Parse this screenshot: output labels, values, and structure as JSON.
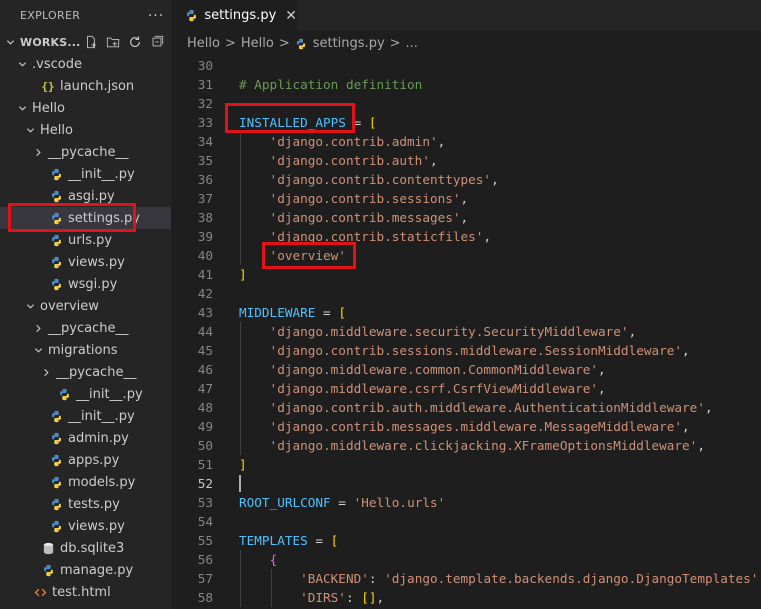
{
  "sidebar": {
    "title": "EXPLORER",
    "more": "···",
    "tree": [
      {
        "label": "WORKS...",
        "depth": 0,
        "chev": "down",
        "icon": "none",
        "workspace": true
      },
      {
        "label": ".vscode",
        "depth": 1,
        "chev": "down",
        "icon": "none"
      },
      {
        "label": "launch.json",
        "depth": 2,
        "chev": "none",
        "icon": "json"
      },
      {
        "label": "Hello",
        "depth": 1,
        "chev": "down",
        "icon": "none"
      },
      {
        "label": "Hello",
        "depth": 2,
        "chev": "down",
        "icon": "none"
      },
      {
        "label": "__pycache__",
        "depth": 3,
        "chev": "right",
        "icon": "none"
      },
      {
        "label": "__init__.py",
        "depth": 3,
        "chev": "none",
        "icon": "python"
      },
      {
        "label": "asgi.py",
        "depth": 3,
        "chev": "none",
        "icon": "python"
      },
      {
        "label": "settings.py",
        "depth": 3,
        "chev": "none",
        "icon": "python",
        "selected": true
      },
      {
        "label": "urls.py",
        "depth": 3,
        "chev": "none",
        "icon": "python"
      },
      {
        "label": "views.py",
        "depth": 3,
        "chev": "none",
        "icon": "python"
      },
      {
        "label": "wsgi.py",
        "depth": 3,
        "chev": "none",
        "icon": "python"
      },
      {
        "label": "overview",
        "depth": 2,
        "chev": "down",
        "icon": "none"
      },
      {
        "label": "__pycache__",
        "depth": 3,
        "chev": "right",
        "icon": "none"
      },
      {
        "label": "migrations",
        "depth": 3,
        "chev": "down",
        "icon": "none"
      },
      {
        "label": "__pycache__",
        "depth": 4,
        "chev": "right",
        "icon": "none"
      },
      {
        "label": "__init__.py",
        "depth": 4,
        "chev": "none",
        "icon": "python"
      },
      {
        "label": "__init__.py",
        "depth": 3,
        "chev": "none",
        "icon": "python"
      },
      {
        "label": "admin.py",
        "depth": 3,
        "chev": "none",
        "icon": "python"
      },
      {
        "label": "apps.py",
        "depth": 3,
        "chev": "none",
        "icon": "python"
      },
      {
        "label": "models.py",
        "depth": 3,
        "chev": "none",
        "icon": "python"
      },
      {
        "label": "tests.py",
        "depth": 3,
        "chev": "none",
        "icon": "python"
      },
      {
        "label": "views.py",
        "depth": 3,
        "chev": "none",
        "icon": "python"
      },
      {
        "label": "db.sqlite3",
        "depth": 2,
        "chev": "none",
        "icon": "database"
      },
      {
        "label": "manage.py",
        "depth": 2,
        "chev": "none",
        "icon": "python"
      },
      {
        "label": "test.html",
        "depth": 1,
        "chev": "none",
        "icon": "html"
      }
    ]
  },
  "tab": {
    "label": "settings.py",
    "close": "✕"
  },
  "breadcrumbs": {
    "items": [
      "Hello",
      "Hello",
      "settings.py",
      "..."
    ],
    "sep": ">"
  },
  "colors": {
    "highlight": "#e0131a",
    "python_blue": "#4f8fc9",
    "python_yellow": "#f7d44a"
  },
  "editor": {
    "lines": [
      {
        "n": "30",
        "t": []
      },
      {
        "n": "31",
        "t": [
          {
            "c": "comment",
            "s": "# Application definition"
          }
        ]
      },
      {
        "n": "32",
        "t": []
      },
      {
        "n": "33",
        "t": [
          {
            "c": "var",
            "s": "INSTALLED_APPS"
          },
          {
            "c": "op",
            "s": " = "
          },
          {
            "c": "b1",
            "s": "["
          }
        ]
      },
      {
        "n": "34",
        "t": [
          {
            "c": "str",
            "s": "    'django.contrib.admin'"
          },
          {
            "c": "op",
            "s": ","
          }
        ]
      },
      {
        "n": "35",
        "t": [
          {
            "c": "str",
            "s": "    'django.contrib.auth'"
          },
          {
            "c": "op",
            "s": ","
          }
        ]
      },
      {
        "n": "36",
        "t": [
          {
            "c": "str",
            "s": "    'django.contrib.contenttypes'"
          },
          {
            "c": "op",
            "s": ","
          }
        ]
      },
      {
        "n": "37",
        "t": [
          {
            "c": "str",
            "s": "    'django.contrib.sessions'"
          },
          {
            "c": "op",
            "s": ","
          }
        ]
      },
      {
        "n": "38",
        "t": [
          {
            "c": "str",
            "s": "    'django.contrib.messages'"
          },
          {
            "c": "op",
            "s": ","
          }
        ]
      },
      {
        "n": "39",
        "t": [
          {
            "c": "str",
            "s": "    'django.contrib.staticfiles'"
          },
          {
            "c": "op",
            "s": ","
          }
        ]
      },
      {
        "n": "40",
        "t": [
          {
            "c": "str",
            "s": "    'overview'"
          }
        ]
      },
      {
        "n": "41",
        "t": [
          {
            "c": "b1",
            "s": "]"
          }
        ]
      },
      {
        "n": "42",
        "t": []
      },
      {
        "n": "43",
        "t": [
          {
            "c": "var",
            "s": "MIDDLEWARE"
          },
          {
            "c": "op",
            "s": " = "
          },
          {
            "c": "b1",
            "s": "["
          }
        ]
      },
      {
        "n": "44",
        "t": [
          {
            "c": "str",
            "s": "    'django.middleware.security.SecurityMiddleware'"
          },
          {
            "c": "op",
            "s": ","
          }
        ]
      },
      {
        "n": "45",
        "t": [
          {
            "c": "str",
            "s": "    'django.contrib.sessions.middleware.SessionMiddleware'"
          },
          {
            "c": "op",
            "s": ","
          }
        ]
      },
      {
        "n": "46",
        "t": [
          {
            "c": "str",
            "s": "    'django.middleware.common.CommonMiddleware'"
          },
          {
            "c": "op",
            "s": ","
          }
        ]
      },
      {
        "n": "47",
        "t": [
          {
            "c": "str",
            "s": "    'django.middleware.csrf.CsrfViewMiddleware'"
          },
          {
            "c": "op",
            "s": ","
          }
        ]
      },
      {
        "n": "48",
        "t": [
          {
            "c": "str",
            "s": "    'django.contrib.auth.middleware.AuthenticationMiddleware'"
          },
          {
            "c": "op",
            "s": ","
          }
        ]
      },
      {
        "n": "49",
        "t": [
          {
            "c": "str",
            "s": "    'django.contrib.messages.middleware.MessageMiddleware'"
          },
          {
            "c": "op",
            "s": ","
          }
        ]
      },
      {
        "n": "50",
        "t": [
          {
            "c": "str",
            "s": "    'django.middleware.clickjacking.XFrameOptionsMiddleware'"
          },
          {
            "c": "op",
            "s": ","
          }
        ]
      },
      {
        "n": "51",
        "t": [
          {
            "c": "b1",
            "s": "]"
          }
        ]
      },
      {
        "n": "52",
        "t": [],
        "active": true
      },
      {
        "n": "53",
        "t": [
          {
            "c": "var",
            "s": "ROOT_URLCONF"
          },
          {
            "c": "op",
            "s": " = "
          },
          {
            "c": "str",
            "s": "'Hello.urls'"
          }
        ]
      },
      {
        "n": "54",
        "t": []
      },
      {
        "n": "55",
        "t": [
          {
            "c": "var",
            "s": "TEMPLATES"
          },
          {
            "c": "op",
            "s": " = "
          },
          {
            "c": "b1",
            "s": "["
          }
        ]
      },
      {
        "n": "56",
        "t": [
          {
            "c": "plain",
            "s": "    "
          },
          {
            "c": "b2",
            "s": "{"
          }
        ]
      },
      {
        "n": "57",
        "t": [
          {
            "c": "str",
            "s": "        'BACKEND'"
          },
          {
            "c": "op",
            "s": ": "
          },
          {
            "c": "str",
            "s": "'django.template.backends.django.DjangoTemplates'"
          },
          {
            "c": "op",
            "s": ","
          }
        ]
      },
      {
        "n": "58",
        "t": [
          {
            "c": "str",
            "s": "        'DIRS'"
          },
          {
            "c": "op",
            "s": ": "
          },
          {
            "c": "b1",
            "s": "[]"
          },
          {
            "c": "op",
            "s": ","
          }
        ]
      }
    ]
  }
}
